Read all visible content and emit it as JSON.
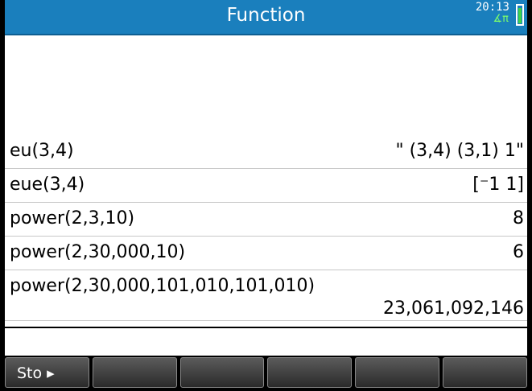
{
  "titlebar": {
    "title": "Function",
    "clock": "20:13",
    "angle_indicator": "∡π",
    "battery_icon": "battery-icon",
    "battery_level_percent": 90
  },
  "history": [
    {
      "input": "eu(3,4)",
      "output": "\" (3,4) (3,1)   1\""
    },
    {
      "input": "eue(3,4)",
      "output": "[⁻1  1]"
    },
    {
      "input": "power(2,3,10)",
      "output": "8"
    },
    {
      "input": "power(2,30,000,10)",
      "output": "6"
    },
    {
      "input": "power(2,30,000,101,010,101,010)",
      "output": "23,061,092,146"
    }
  ],
  "menu": [
    {
      "label": "Sto ▸"
    },
    {
      "label": ""
    },
    {
      "label": ""
    },
    {
      "label": ""
    },
    {
      "label": ""
    },
    {
      "label": ""
    }
  ],
  "colors": {
    "titlebar": "#1a7fbd",
    "angle_indicator": "#7dff6a",
    "battery": "#3dd44a"
  }
}
